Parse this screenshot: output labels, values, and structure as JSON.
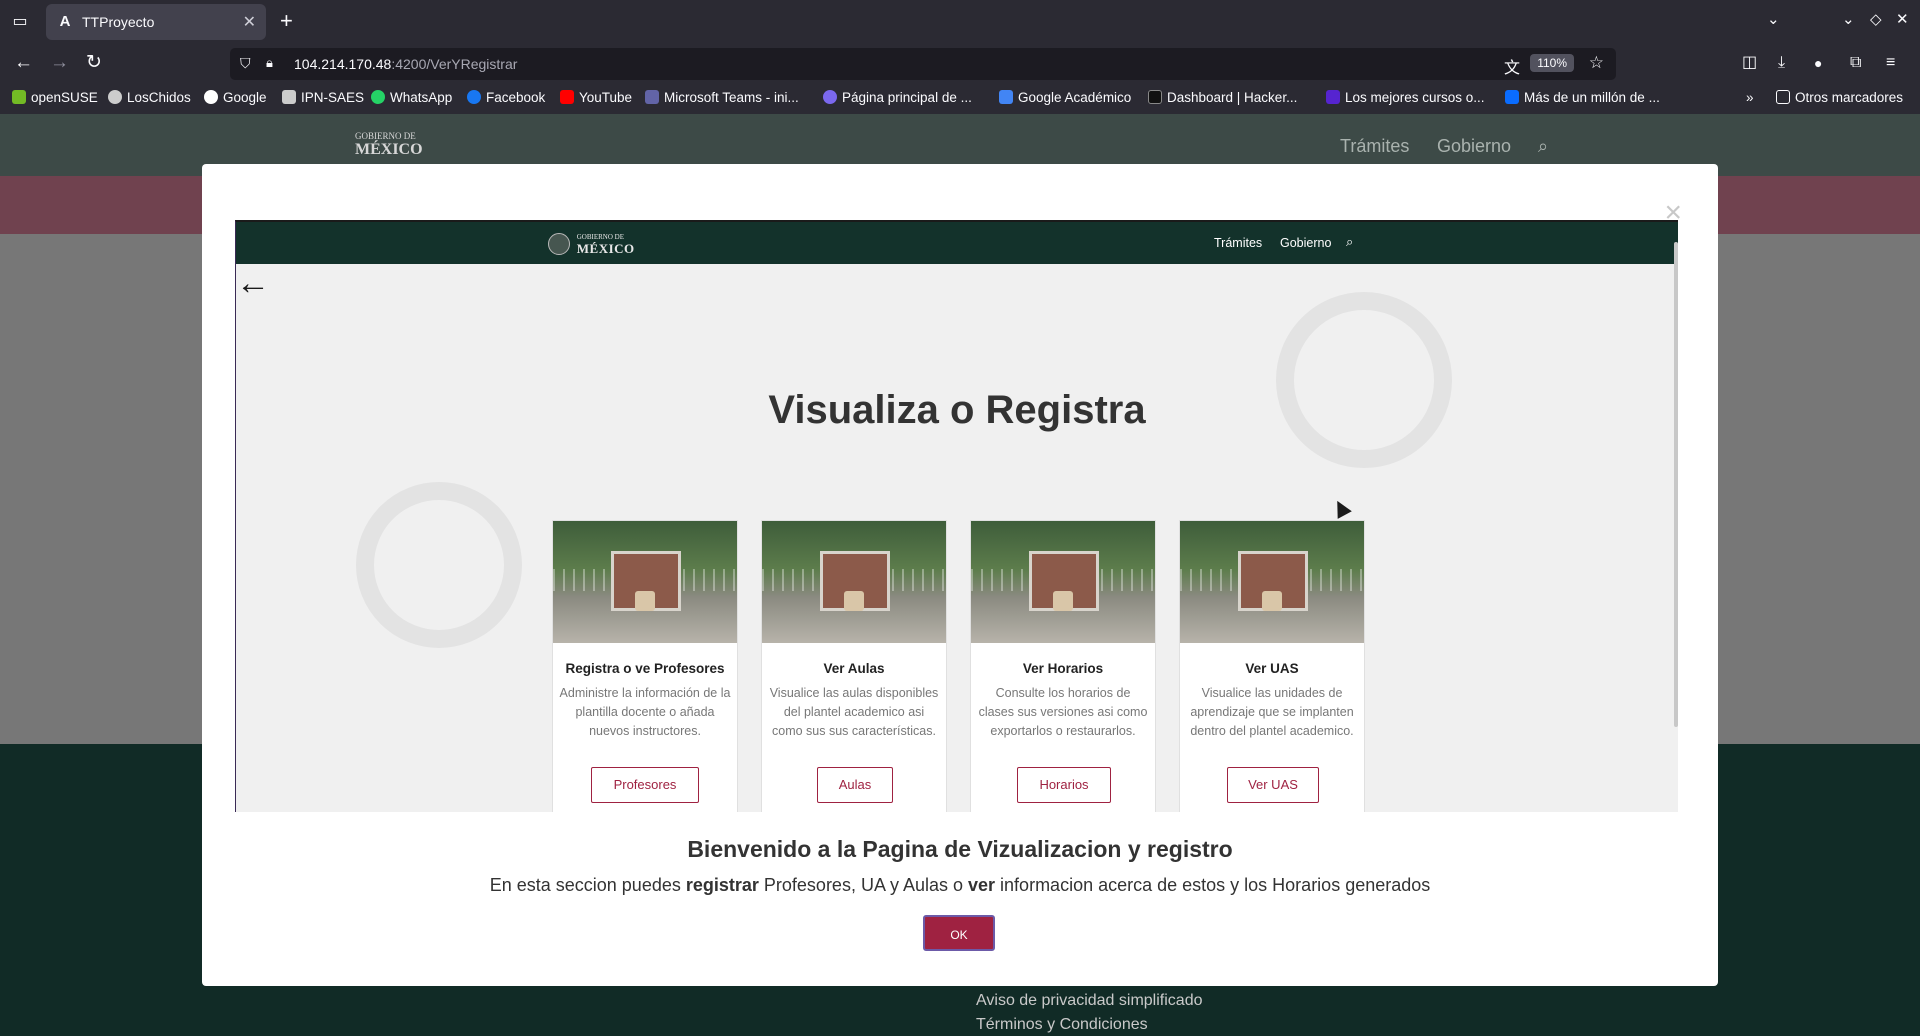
{
  "browser": {
    "tab_title": "TTProyecto",
    "tab_favicon": "A",
    "url_host": "104.214.170.48",
    "url_path": ":4200/VerYRegistrar",
    "zoom": "110%",
    "bookmarks": [
      {
        "label": "openSUSE",
        "color": "#73ba25"
      },
      {
        "label": "LosChidos",
        "color": "#cccccc"
      },
      {
        "label": "Google",
        "color": "#ffffff"
      },
      {
        "label": "IPN-SAES",
        "color": "#cccccc"
      },
      {
        "label": "WhatsApp",
        "color": "#25d366"
      },
      {
        "label": "Facebook",
        "color": "#1877f2"
      },
      {
        "label": "YouTube",
        "color": "#ff0000"
      },
      {
        "label": "Microsoft Teams - ini...",
        "color": "#6264a7"
      },
      {
        "label": "Página principal de ...",
        "color": "#7b68ee"
      },
      {
        "label": "Google Académico",
        "color": "#4285f4"
      },
      {
        "label": "Dashboard | Hacker...",
        "color": "#111111"
      },
      {
        "label": "Los mejores cursos o...",
        "color": "#5624d0"
      },
      {
        "label": "Más de un millón de ...",
        "color": "#0a6cff"
      }
    ],
    "other_bookmarks": "Otros marcadores"
  },
  "background_page": {
    "nav": [
      "Trámites",
      "Gobierno"
    ],
    "logo_small": "GOBIERNO DE",
    "logo_big": "MÉXICO",
    "footer_links": [
      "Aviso de privacidad simplificado",
      "Términos y Condiciones"
    ]
  },
  "modal": {
    "close_glyph": "×",
    "preview": {
      "logo_small": "GOBIERNO DE",
      "logo_big": "MÉXICO",
      "nav": [
        "Trámites",
        "Gobierno"
      ],
      "title": "Visualiza o Registra",
      "cards": [
        {
          "title": "Registra o ve Profesores",
          "description": "Administre la información de la plantilla docente o añada nuevos instructores.",
          "button": "Profesores"
        },
        {
          "title": "Ver Aulas",
          "description": "Visualice las aulas disponibles del plantel academico asi como sus sus características.",
          "button": "Aulas"
        },
        {
          "title": "Ver Horarios",
          "description": "Consulte los horarios de clases sus versiones asi como exportarlos o restaurarlos.",
          "button": "Horarios"
        },
        {
          "title": "Ver UAS",
          "description": "Visualice las unidades de aprendizaje que se implanten dentro del plantel academico.",
          "button": "Ver UAS"
        }
      ]
    },
    "heading": "Bienvenido a la Pagina de Vizualizacion y registro",
    "text_1": "En esta seccion puedes ",
    "text_bold_1": "registrar",
    "text_2": " Profesores, UA y Aulas o ",
    "text_bold_2": "ver",
    "text_3": " informacion acerca de estos y los Horarios generados",
    "ok_label": "OK"
  },
  "colors": {
    "brand_maroon": "#9f2241",
    "gov_green": "#13322b"
  }
}
